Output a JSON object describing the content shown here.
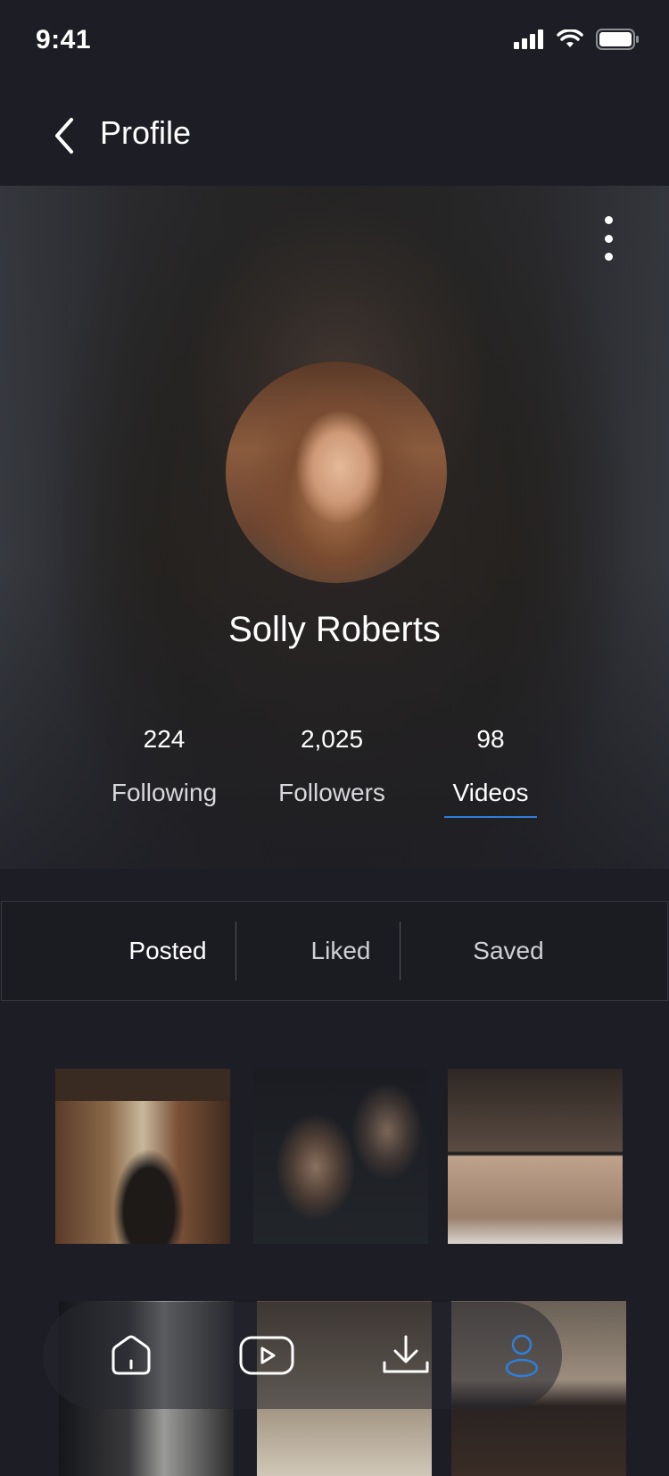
{
  "status_bar": {
    "time": "9:41"
  },
  "nav": {
    "title": "Profile"
  },
  "profile": {
    "name": "Solly Roberts"
  },
  "stats": [
    {
      "value": "224",
      "label": "Following"
    },
    {
      "value": "2,025",
      "label": "Followers"
    },
    {
      "value": "98",
      "label": "Videos"
    }
  ],
  "tabs": [
    {
      "label": "Posted"
    },
    {
      "label": "Liked"
    },
    {
      "label": "Saved"
    }
  ],
  "bottom_nav": [
    "home-icon",
    "video-icon",
    "download-icon",
    "profile-icon"
  ],
  "colors": {
    "background": "#1d1e25",
    "accent": "#2f7fd6"
  }
}
